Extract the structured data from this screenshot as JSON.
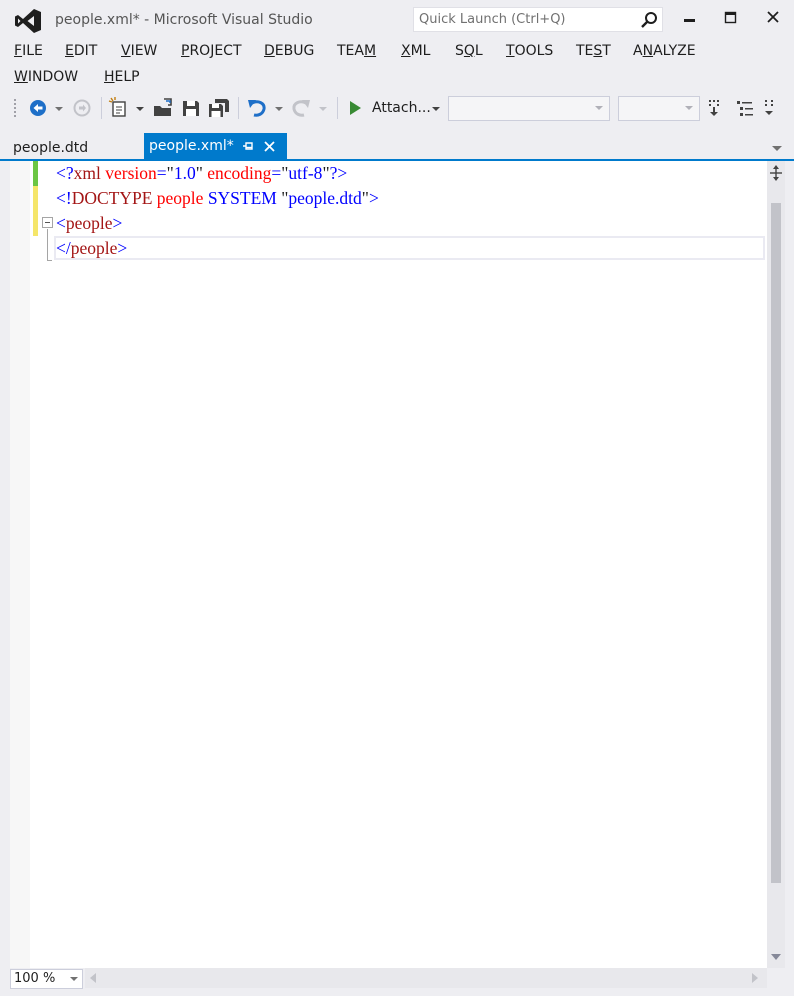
{
  "window": {
    "title": "people.xml* - Microsoft Visual Studio",
    "quick_launch_placeholder": "Quick Launch (Ctrl+Q)",
    "icons": [
      "vs-logo-icon",
      "search-icon",
      "minimize-icon",
      "maximize-icon",
      "close-icon"
    ]
  },
  "menu": [
    {
      "pre": "",
      "key": "F",
      "post": "ILE"
    },
    {
      "pre": "",
      "key": "E",
      "post": "DIT"
    },
    {
      "pre": "",
      "key": "V",
      "post": "IEW"
    },
    {
      "pre": "",
      "key": "P",
      "post": "ROJECT"
    },
    {
      "pre": "",
      "key": "D",
      "post": "EBUG"
    },
    {
      "pre": "TEA",
      "key": "M",
      "post": ""
    },
    {
      "pre": "",
      "key": "X",
      "post": "ML"
    },
    {
      "pre": "S",
      "key": "Q",
      "post": "L"
    },
    {
      "pre": "",
      "key": "T",
      "post": "OOLS"
    },
    {
      "pre": "TE",
      "key": "S",
      "post": "T"
    },
    {
      "pre": "A",
      "key": "N",
      "post": "ALYZE"
    },
    {
      "pre": "",
      "key": "W",
      "post": "INDOW"
    },
    {
      "pre": "",
      "key": "H",
      "post": "ELP"
    }
  ],
  "toolbar": {
    "attach_label": "Attach...",
    "icons": [
      "back-icon",
      "forward-icon",
      "new-project-icon",
      "open-file-icon",
      "save-icon",
      "save-all-icon",
      "undo-icon",
      "redo-icon",
      "start-icon"
    ]
  },
  "tabs": {
    "inactive_label": "people.dtd",
    "active_label": "people.xml*"
  },
  "editor": {
    "zoom": "100 %",
    "lines": [
      [
        [
          "<?",
          "blue"
        ],
        [
          "xml",
          "maroon"
        ],
        [
          " ",
          "blue"
        ],
        [
          "version",
          "red"
        ],
        [
          "=",
          "blue"
        ],
        [
          "\"",
          "dark"
        ],
        [
          "1.0",
          "blue"
        ],
        [
          "\"",
          "dark"
        ],
        [
          " ",
          "blue"
        ],
        [
          "encoding",
          "red"
        ],
        [
          "=",
          "blue"
        ],
        [
          "\"",
          "dark"
        ],
        [
          "utf-8",
          "blue"
        ],
        [
          "\"",
          "dark"
        ],
        [
          "?>",
          "blue"
        ]
      ],
      [
        [
          "<!",
          "blue"
        ],
        [
          "DOCTYPE",
          "maroon"
        ],
        [
          " ",
          "blue"
        ],
        [
          "people",
          "red"
        ],
        [
          " ",
          "blue"
        ],
        [
          "SYSTEM",
          "blue"
        ],
        [
          " ",
          "blue"
        ],
        [
          "\"",
          "dark"
        ],
        [
          "people.dtd",
          "blue"
        ],
        [
          "\"",
          "dark"
        ],
        [
          ">",
          "blue"
        ]
      ],
      [
        [
          "<",
          "blue"
        ],
        [
          "people",
          "maroon"
        ],
        [
          ">",
          "blue"
        ]
      ],
      [
        [
          "</",
          "blue"
        ],
        [
          "people",
          "maroon"
        ],
        [
          ">",
          "blue"
        ]
      ]
    ],
    "change_markers": [
      "#6cc644",
      "#f5e66a",
      "#f5e66a"
    ]
  }
}
